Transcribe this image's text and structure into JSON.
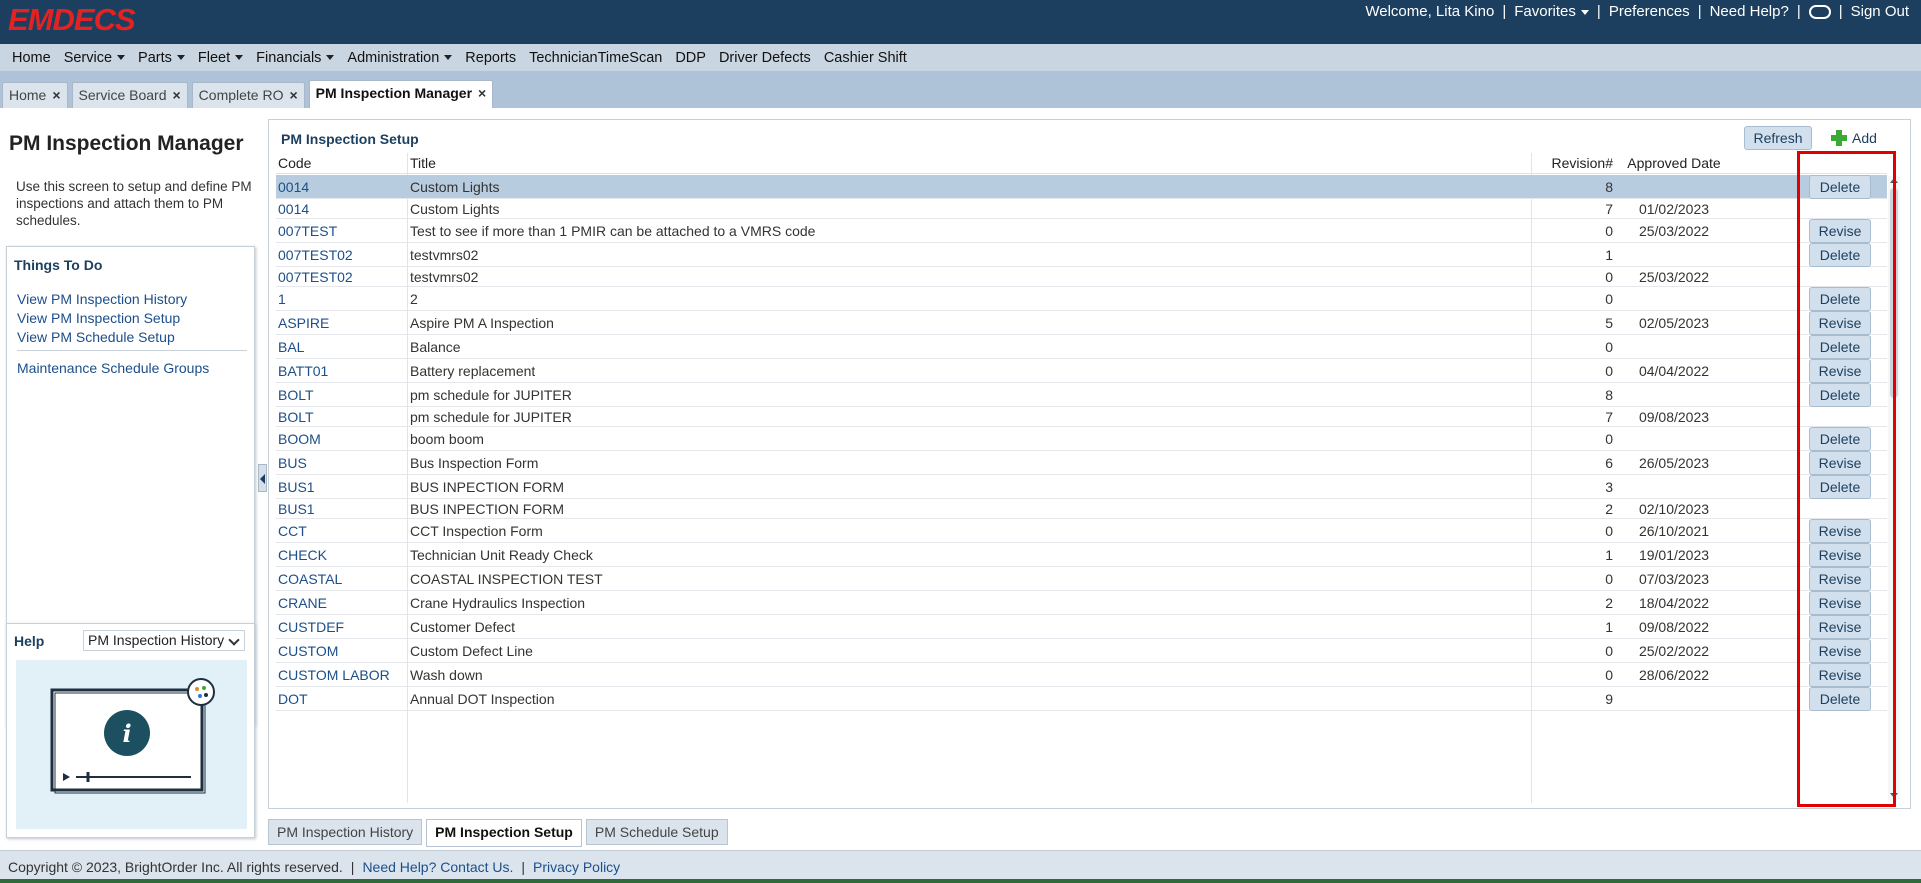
{
  "brand": {
    "logo": "EMDECS"
  },
  "topbar": {
    "welcome": "Welcome, Lita Kino",
    "favorites": "Favorites",
    "preferences": "Preferences",
    "need_help": "Need Help?",
    "sign_out": "Sign Out"
  },
  "nav": [
    {
      "label": "Home",
      "dropdown": false
    },
    {
      "label": "Service",
      "dropdown": true
    },
    {
      "label": "Parts",
      "dropdown": true
    },
    {
      "label": "Fleet",
      "dropdown": true
    },
    {
      "label": "Financials",
      "dropdown": true
    },
    {
      "label": "Administration",
      "dropdown": true
    },
    {
      "label": "Reports",
      "dropdown": false
    },
    {
      "label": "TechnicianTimeScan",
      "dropdown": false
    },
    {
      "label": "DDP",
      "dropdown": false
    },
    {
      "label": "Driver Defects",
      "dropdown": false
    },
    {
      "label": "Cashier Shift",
      "dropdown": false
    }
  ],
  "doc_tabs": [
    {
      "label": "Home",
      "active": false
    },
    {
      "label": "Service Board",
      "active": false
    },
    {
      "label": "Complete RO",
      "active": false
    },
    {
      "label": "PM Inspection Manager",
      "active": true
    }
  ],
  "left": {
    "page_title": "PM Inspection Manager",
    "description": "Use this screen to setup and define PM inspections and attach them to PM schedules.",
    "todo_title": "Things To Do",
    "todo_links": [
      "View PM Inspection History",
      "View PM Inspection Setup",
      "View PM Schedule Setup"
    ],
    "todo_extra": "Maintenance Schedule Groups",
    "help_title": "Help",
    "help_selected": "PM Inspection History"
  },
  "main": {
    "panel_title": "PM Inspection Setup",
    "refresh_label": "Refresh",
    "add_label": "Add",
    "columns": {
      "code": "Code",
      "title": "Title",
      "revision": "Revision#",
      "approved": "Approved Date"
    }
  },
  "rows": [
    {
      "code": "0014",
      "title": "Custom Lights",
      "rev": "8",
      "date": "",
      "action": "Delete",
      "selected": true
    },
    {
      "code": "0014",
      "title": "Custom Lights",
      "rev": "7",
      "date": "01/02/2023",
      "action": ""
    },
    {
      "code": "007TEST",
      "title": "Test to see if more than 1 PMIR can be attached to a VMRS code",
      "rev": "0",
      "date": "25/03/2022",
      "action": "Revise"
    },
    {
      "code": "007TEST02",
      "title": "testvmrs02",
      "rev": "1",
      "date": "",
      "action": "Delete"
    },
    {
      "code": "007TEST02",
      "title": "testvmrs02",
      "rev": "0",
      "date": "25/03/2022",
      "action": ""
    },
    {
      "code": "1",
      "title": "2",
      "rev": "0",
      "date": "",
      "action": "Delete"
    },
    {
      "code": "ASPIRE",
      "title": "Aspire PM A Inspection",
      "rev": "5",
      "date": "02/05/2023",
      "action": "Revise"
    },
    {
      "code": "BAL",
      "title": "Balance",
      "rev": "0",
      "date": "",
      "action": "Delete"
    },
    {
      "code": "BATT01",
      "title": "Battery replacement",
      "rev": "0",
      "date": "04/04/2022",
      "action": "Revise"
    },
    {
      "code": "BOLT",
      "title": "pm schedule for JUPITER",
      "rev": "8",
      "date": "",
      "action": "Delete"
    },
    {
      "code": "BOLT",
      "title": "pm schedule for JUPITER",
      "rev": "7",
      "date": "09/08/2023",
      "action": ""
    },
    {
      "code": "BOOM",
      "title": "boom boom",
      "rev": "0",
      "date": "",
      "action": "Delete"
    },
    {
      "code": "BUS",
      "title": "Bus Inspection Form",
      "rev": "6",
      "date": "26/05/2023",
      "action": "Revise"
    },
    {
      "code": "BUS1",
      "title": "BUS INPECTION FORM",
      "rev": "3",
      "date": "",
      "action": "Delete"
    },
    {
      "code": "BUS1",
      "title": "BUS INPECTION FORM",
      "rev": "2",
      "date": "02/10/2023",
      "action": ""
    },
    {
      "code": "CCT",
      "title": "CCT Inspection Form",
      "rev": "0",
      "date": "26/10/2021",
      "action": "Revise"
    },
    {
      "code": "CHECK",
      "title": "Technician Unit Ready Check",
      "rev": "1",
      "date": "19/01/2023",
      "action": "Revise"
    },
    {
      "code": "COASTAL",
      "title": "COASTAL INSPECTION TEST",
      "rev": "0",
      "date": "07/03/2023",
      "action": "Revise"
    },
    {
      "code": "CRANE",
      "title": "Crane Hydraulics Inspection",
      "rev": "2",
      "date": "18/04/2022",
      "action": "Revise"
    },
    {
      "code": "CUSTDEF",
      "title": "Customer Defect",
      "rev": "1",
      "date": "09/08/2022",
      "action": "Revise"
    },
    {
      "code": "CUSTOM",
      "title": "Custom Defect Line",
      "rev": "0",
      "date": "25/02/2022",
      "action": "Revise"
    },
    {
      "code": "CUSTOM LABOR",
      "title": "Wash down",
      "rev": "0",
      "date": "28/06/2022",
      "action": "Revise"
    },
    {
      "code": "DOT",
      "title": "Annual DOT Inspection",
      "rev": "9",
      "date": "",
      "action": "Delete"
    }
  ],
  "bottom_tabs": [
    {
      "label": "PM Inspection History",
      "active": false
    },
    {
      "label": "PM Inspection Setup",
      "active": true
    },
    {
      "label": "PM Schedule Setup",
      "active": false
    }
  ],
  "footer": {
    "copyright": "Copyright © 2023, BrightOrder Inc. All rights reserved.",
    "help_link": "Need Help? Contact Us.",
    "privacy_link": "Privacy Policy"
  }
}
